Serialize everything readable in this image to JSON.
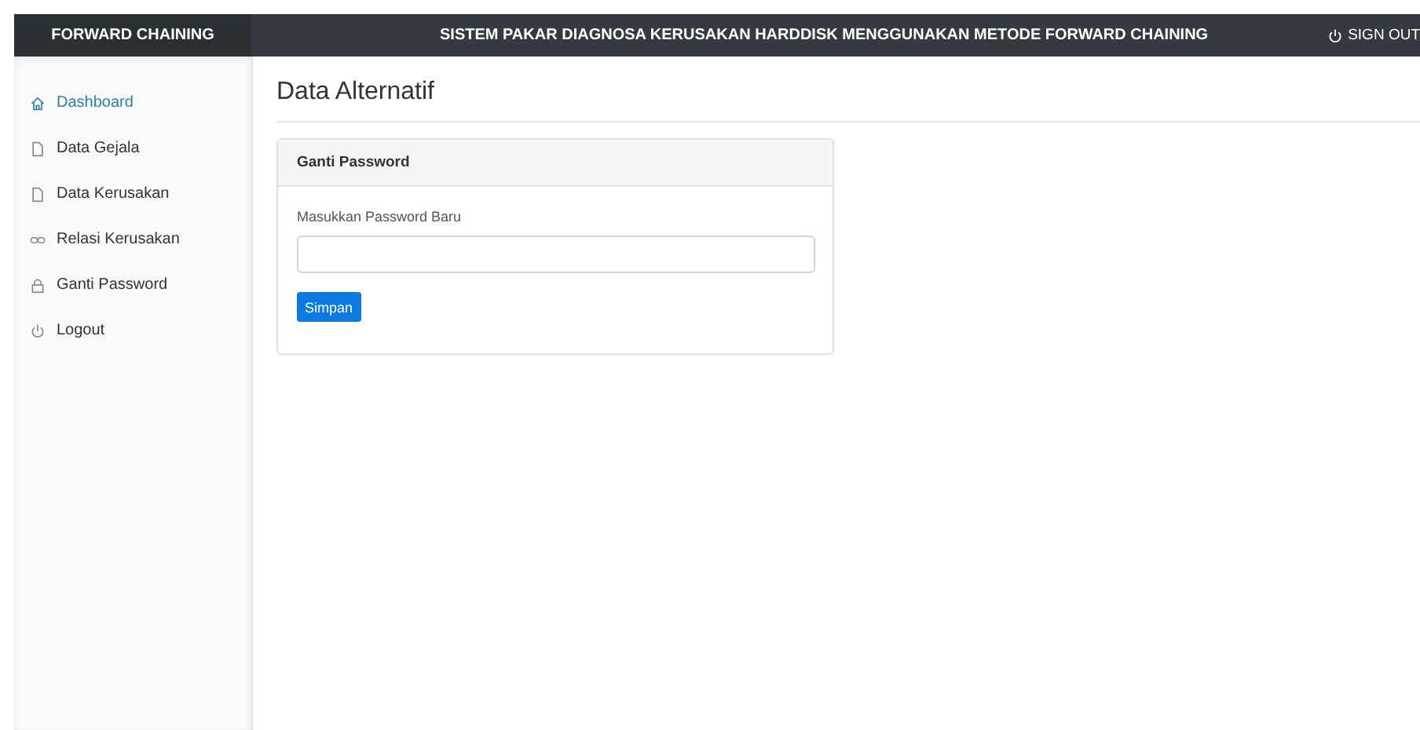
{
  "brand": "FORWARD CHAINING",
  "header": {
    "title": "SISTEM PAKAR DIAGNOSA KERUSAKAN HARDDISK MENGGUNAKAN METODE FORWARD CHAINING",
    "sign_out": "SIGN OUT"
  },
  "sidebar": {
    "items": [
      {
        "label": "Dashboard",
        "selected": true
      },
      {
        "label": "Data Gejala",
        "selected": false
      },
      {
        "label": "Data Kerusakan",
        "selected": false
      },
      {
        "label": "Relasi Kerusakan",
        "selected": false
      },
      {
        "label": "Ganti Password",
        "selected": false
      },
      {
        "label": "Logout",
        "selected": false
      }
    ]
  },
  "page_title": "Data Alternatif",
  "card": {
    "title": "Ganti Password",
    "field_label": "Masukkan Password Baru",
    "button": "Simpan"
  }
}
